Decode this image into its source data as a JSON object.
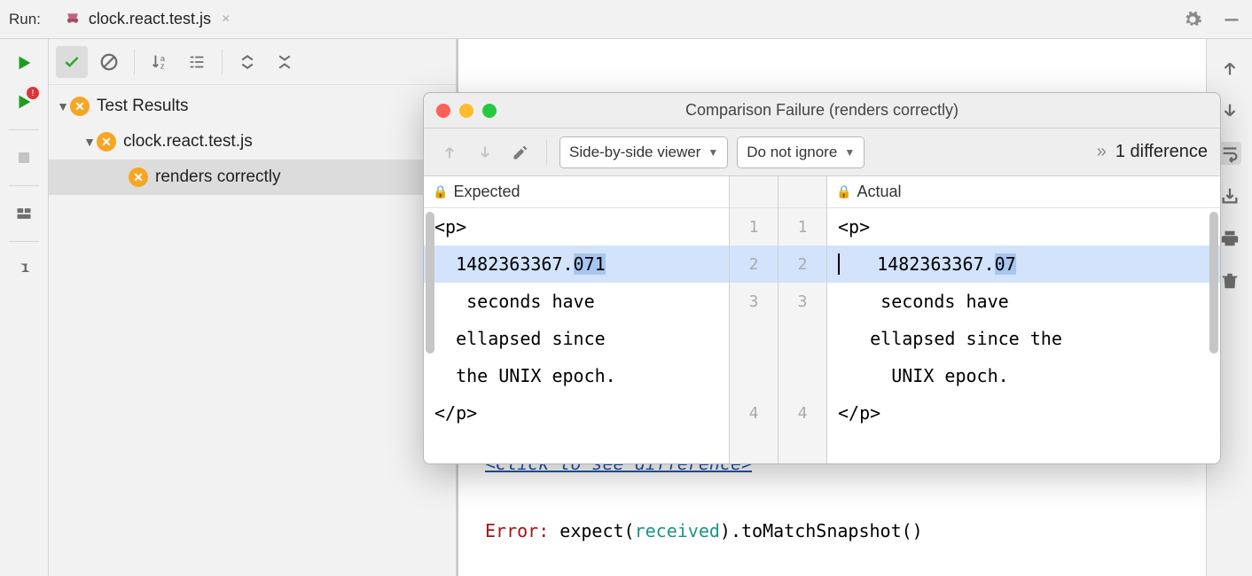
{
  "topbar": {
    "run_label": "Run:",
    "tab_label": "clock.react.test.js"
  },
  "tree": {
    "root_label": "Test Results",
    "file_label": "clock.react.test.js",
    "test_label": "renders correctly"
  },
  "console": {
    "link_text": "<Click to see difference>",
    "error_prefix": "Error:",
    "error_rest_1": " expect(",
    "error_recv": "received",
    "error_rest_2": ").toMatchSnapshot()"
  },
  "dialog": {
    "title": "Comparison Failure (renders correctly)",
    "viewer_mode": "Side-by-side viewer",
    "ignore_mode": "Do not ignore",
    "diff_count": "1 difference",
    "expected_label": "Expected",
    "actual_label": "Actual",
    "expected_lines": {
      "l1": "<p>",
      "l2a": "  1482363367.",
      "l2b": "071",
      "l3": "   seconds have",
      "l3b": "  ellapsed since",
      "l3c": "  the UNIX epoch.",
      "l4": "</p>"
    },
    "actual_lines": {
      "l1": "<p>",
      "l2a": "   1482363367.",
      "l2b": "07",
      "l3": "    seconds have",
      "l3b": "   ellapsed since the",
      "l3c": "     UNIX epoch.",
      "l4": "</p>"
    },
    "gutter_left": {
      "n1": "1",
      "n2": "2",
      "n3": "3",
      "n4": "4"
    },
    "gutter_right": {
      "n1": "1",
      "n2": "2",
      "n3": "3",
      "n4": "4"
    }
  }
}
